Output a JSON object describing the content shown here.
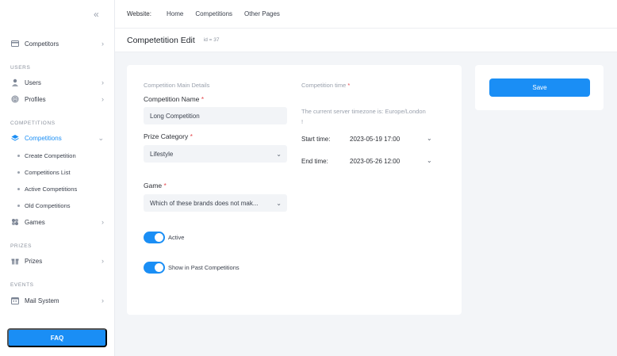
{
  "sidebar": {
    "collapse_icon": "chevron-left-double-icon",
    "items": [
      {
        "label": "Competitors"
      },
      {
        "label": "Users"
      },
      {
        "label": "Profiles"
      },
      {
        "label": "Competitions"
      },
      {
        "label": "Games"
      },
      {
        "label": "Prizes"
      },
      {
        "label": "Mail System"
      }
    ],
    "sections": [
      "USERS",
      "COMPETITIONS",
      "PRIZES",
      "EVENTS"
    ],
    "sub_items": [
      "Create Competition",
      "Competitions List",
      "Active Competitions",
      "Old Competitions"
    ],
    "faq_label": "FAQ"
  },
  "topbar": {
    "website_label": "Website:",
    "links": [
      "Home",
      "Competitions",
      "Other Pages"
    ]
  },
  "header": {
    "title": "Competetition Edit",
    "id_tag": "id = 37"
  },
  "form": {
    "main_details_heading": "Competition Main Details",
    "name_label": "Competition Name",
    "name_value": "Long Competition",
    "prize_label": "Prize Category",
    "prize_value": "Lifestyle",
    "game_label": "Game",
    "game_value": "Which of these brands does not mak...",
    "required_mark": "*",
    "active_label": "Active",
    "past_label": "Show in Past Competitions",
    "time_heading": "Competition time",
    "timezone_note": "The current server timezone is: Europe/London",
    "timezone_note_end": "!",
    "start_label": "Start time:",
    "start_value": "2023-05-19 17:00",
    "end_label": "End time:",
    "end_value": "2023-05-26 12:00"
  },
  "actions": {
    "save_label": "Save"
  },
  "colors": {
    "accent": "#1a8ef5",
    "required": "#e5484d"
  }
}
